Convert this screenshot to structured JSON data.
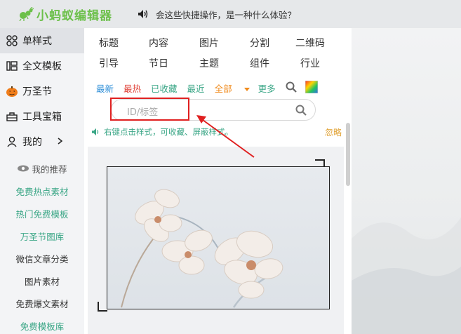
{
  "header": {
    "logo_text": "小蚂蚁编辑器",
    "notice": "会这些快捷操作，是一种什么体验？"
  },
  "sidebar": {
    "items": [
      {
        "label": "单样式",
        "icon": "grid-icon"
      },
      {
        "label": "全文模板",
        "icon": "template-icon"
      },
      {
        "label": "万圣节",
        "icon": "pumpkin-icon"
      },
      {
        "label": "工具宝箱",
        "icon": "toolbox-icon"
      },
      {
        "label": "我的",
        "icon": "user-icon"
      }
    ],
    "sub_items": [
      {
        "label": "我的推荐",
        "color": "#555555"
      },
      {
        "label": "免费热点素材",
        "color": "#3aa686"
      },
      {
        "label": "热门免费模板",
        "color": "#3aa686"
      },
      {
        "label": "万圣节图库",
        "color": "#3aa686"
      },
      {
        "label": "微信文章分类",
        "color": "#333333"
      },
      {
        "label": "图片素材",
        "color": "#333333"
      },
      {
        "label": "免费爆文素材",
        "color": "#333333"
      },
      {
        "label": "免费模板库",
        "color": "#3aa686"
      }
    ]
  },
  "categories_row1": [
    "标题",
    "内容",
    "图片",
    "分割",
    "二维码"
  ],
  "categories_row2": [
    "引导",
    "节日",
    "主题",
    "组件",
    "行业"
  ],
  "filters": [
    {
      "label": "最新",
      "color": "#2f8fd8"
    },
    {
      "label": "最热",
      "color": "#e0443a"
    },
    {
      "label": "已收藏",
      "color": "#3aa686"
    },
    {
      "label": "最近",
      "color": "#3aa686"
    },
    {
      "label": "全部",
      "color": "#f08a1c"
    },
    {
      "label": "更多",
      "color": "#3aa686"
    }
  ],
  "search": {
    "placeholder": "ID/标签"
  },
  "tip": "右键点击样式，可收藏、屏蔽样式。",
  "ignore": "忽略",
  "colors": {
    "brand": "#6cc04a",
    "accent": "#3aa686",
    "highlight": "#e02020"
  }
}
